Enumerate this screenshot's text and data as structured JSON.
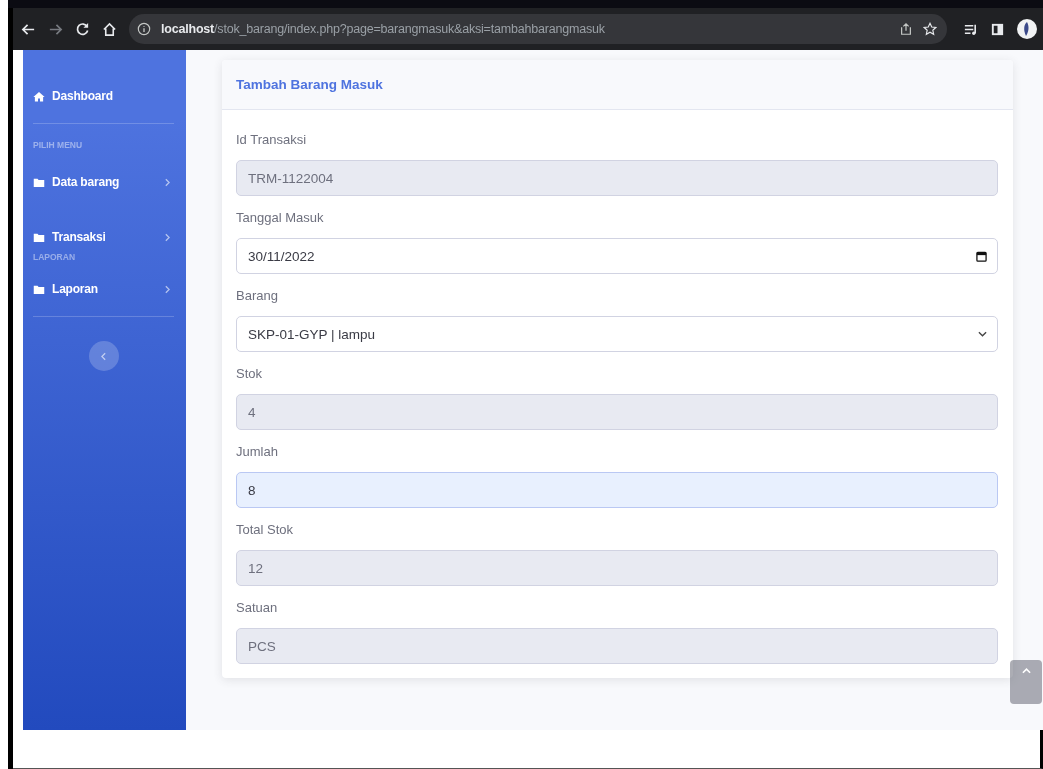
{
  "browser": {
    "url_host": "localhost",
    "url_path": "/stok_barang/index.php?page=barangmasuk&aksi=tambahbarangmasuk",
    "forward_disabled": true
  },
  "sidebar": {
    "items": [
      {
        "kind": "top",
        "label": "Dashboard"
      },
      {
        "kind": "divider"
      },
      {
        "kind": "heading",
        "label": "PILIH MENU"
      },
      {
        "kind": "menu",
        "label": "Data barang"
      },
      {
        "kind": "spacer"
      },
      {
        "kind": "menu",
        "label": "Transaksi"
      },
      {
        "kind": "heading",
        "label": "LAPORAN"
      },
      {
        "kind": "menu",
        "label": "Laporan"
      },
      {
        "kind": "divider"
      },
      {
        "kind": "toggle"
      }
    ]
  },
  "card": {
    "title": "Tambah Barang Masuk",
    "fields": [
      {
        "label": "Id Transaksi",
        "kind": "text",
        "value": "TRM-1122004",
        "disabled": true,
        "focused": false
      },
      {
        "label": "Tanggal Masuk",
        "kind": "date",
        "value": "30/11/2022",
        "disabled": false,
        "focused": false
      },
      {
        "label": "Barang",
        "kind": "select",
        "value": "SKP-01-GYP | lampu",
        "disabled": false,
        "focused": false
      },
      {
        "label": "Stok",
        "kind": "text",
        "value": "4",
        "disabled": true,
        "focused": false
      },
      {
        "label": "Jumlah",
        "kind": "text",
        "value": "8",
        "disabled": false,
        "focused": true
      },
      {
        "label": "Total Stok",
        "kind": "text",
        "value": "12",
        "disabled": true,
        "focused": false
      },
      {
        "label": "Satuan",
        "kind": "text",
        "value": "PCS",
        "disabled": true,
        "focused": false
      }
    ]
  }
}
